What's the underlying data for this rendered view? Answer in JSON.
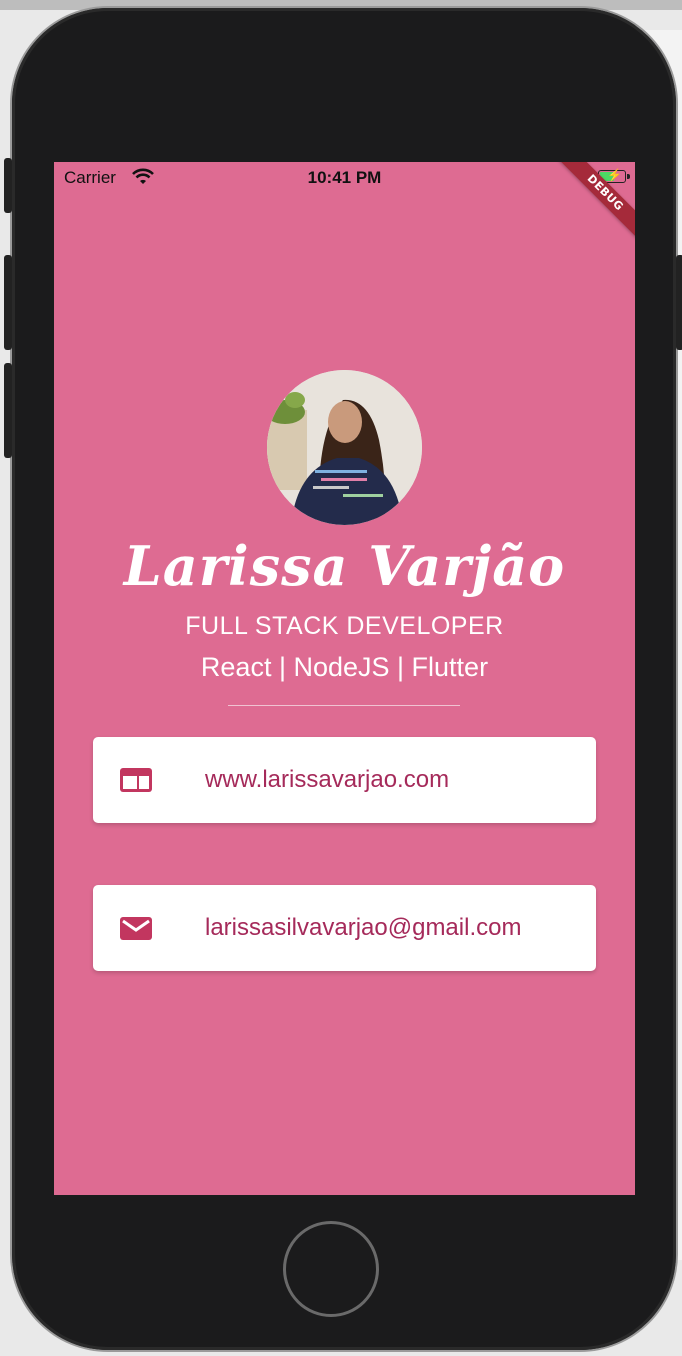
{
  "status_bar": {
    "carrier": "Carrier",
    "time": "10:41 PM"
  },
  "debug_banner": "DEBUG",
  "profile": {
    "name": "Larissa Varjão",
    "title": "FULL STACK DEVELOPER",
    "skills": "React | NodeJS | Flutter"
  },
  "cards": [
    {
      "icon": "web-icon",
      "text": "www.larissavarjao.com"
    },
    {
      "icon": "mail-icon",
      "text": "larissasilvavarjao@gmail.com"
    }
  ],
  "colors": {
    "background": "#de6b92",
    "card_text": "#a52a5a",
    "debug_ribbon": "#a52a3a"
  }
}
